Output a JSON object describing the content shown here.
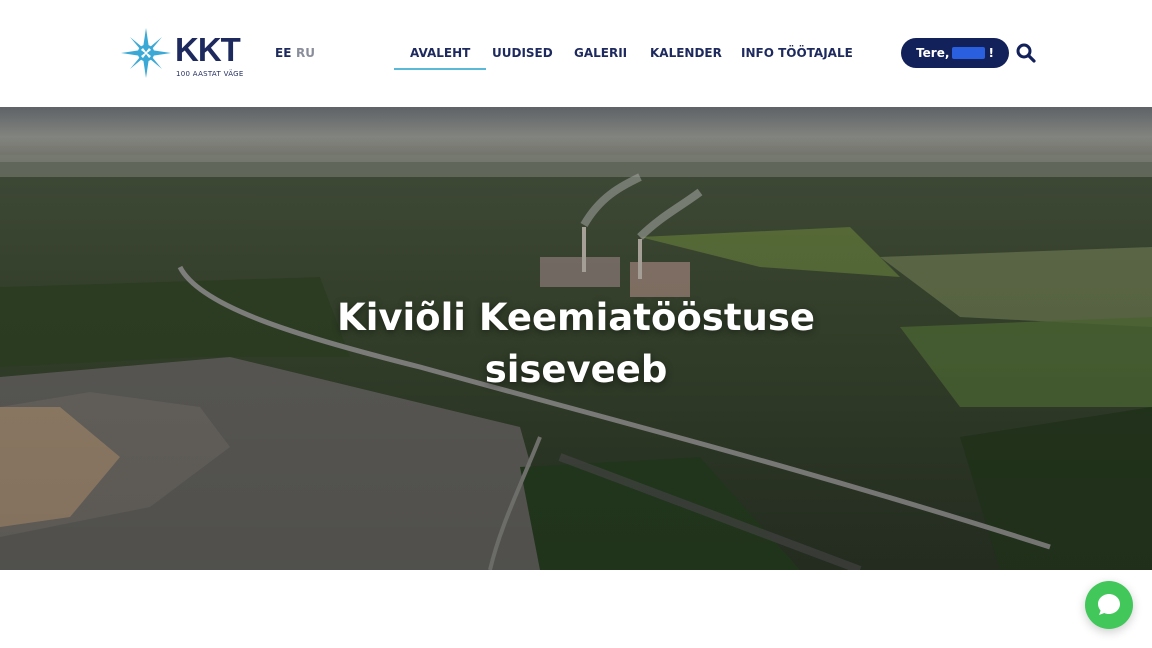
{
  "header": {
    "logo": {
      "brand": "KKT",
      "tagline": "100 AASTAT VÄGE",
      "icon": "compass-star-logo-icon"
    },
    "languages": [
      {
        "code": "EE",
        "active": true
      },
      {
        "code": "RU",
        "active": false
      }
    ],
    "nav": [
      {
        "label": "AVALEHT",
        "active": true
      },
      {
        "label": "UUDISED",
        "active": false
      },
      {
        "label": "GALERII",
        "active": false
      },
      {
        "label": "KALENDER",
        "active": false
      },
      {
        "label": "INFO TÖÖTAJALE",
        "active": false
      }
    ],
    "user_greeting": {
      "prefix": "Tere,",
      "suffix": "!"
    },
    "search_icon": "search-icon"
  },
  "hero": {
    "title_line1": "Kiviõli Keemiatööstuse",
    "title_line2": "siseveeb"
  },
  "chat_button": {
    "icon": "chat-bubble-icon"
  },
  "colors": {
    "brand_navy": "#13215b",
    "accent_blue": "#5bb8d6",
    "chat_green": "#41c75a"
  }
}
